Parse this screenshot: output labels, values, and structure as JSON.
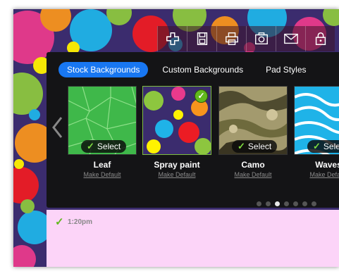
{
  "toolbar": {
    "buttons": [
      {
        "icon": "plus-icon"
      },
      {
        "icon": "save-icon"
      },
      {
        "icon": "print-icon"
      },
      {
        "icon": "camera-icon"
      },
      {
        "icon": "mail-icon"
      },
      {
        "icon": "lock-icon"
      }
    ]
  },
  "tabs": [
    {
      "label": "Stock Backgrounds",
      "active": true
    },
    {
      "label": "Custom Backgrounds",
      "active": false
    },
    {
      "label": "Pad Styles",
      "active": false
    }
  ],
  "backgrounds": [
    {
      "name": "Leaf",
      "action": "Make Default",
      "select_label": "Select",
      "selected": false
    },
    {
      "name": "Spray paint",
      "action": "Make Default",
      "select_label": "",
      "selected": true
    },
    {
      "name": "Camo",
      "action": "Make Default",
      "select_label": "Select",
      "selected": false
    },
    {
      "name": "Waves",
      "action": "Make Default",
      "select_label": "Select",
      "selected": false
    }
  ],
  "pager": {
    "count": 7,
    "active_index": 2
  },
  "pad": {
    "time": "1:20pm"
  },
  "colors": {
    "accent": "#1877f2",
    "check": "#62b81e",
    "pad": "#fcd4f8",
    "panel": "#141416"
  }
}
